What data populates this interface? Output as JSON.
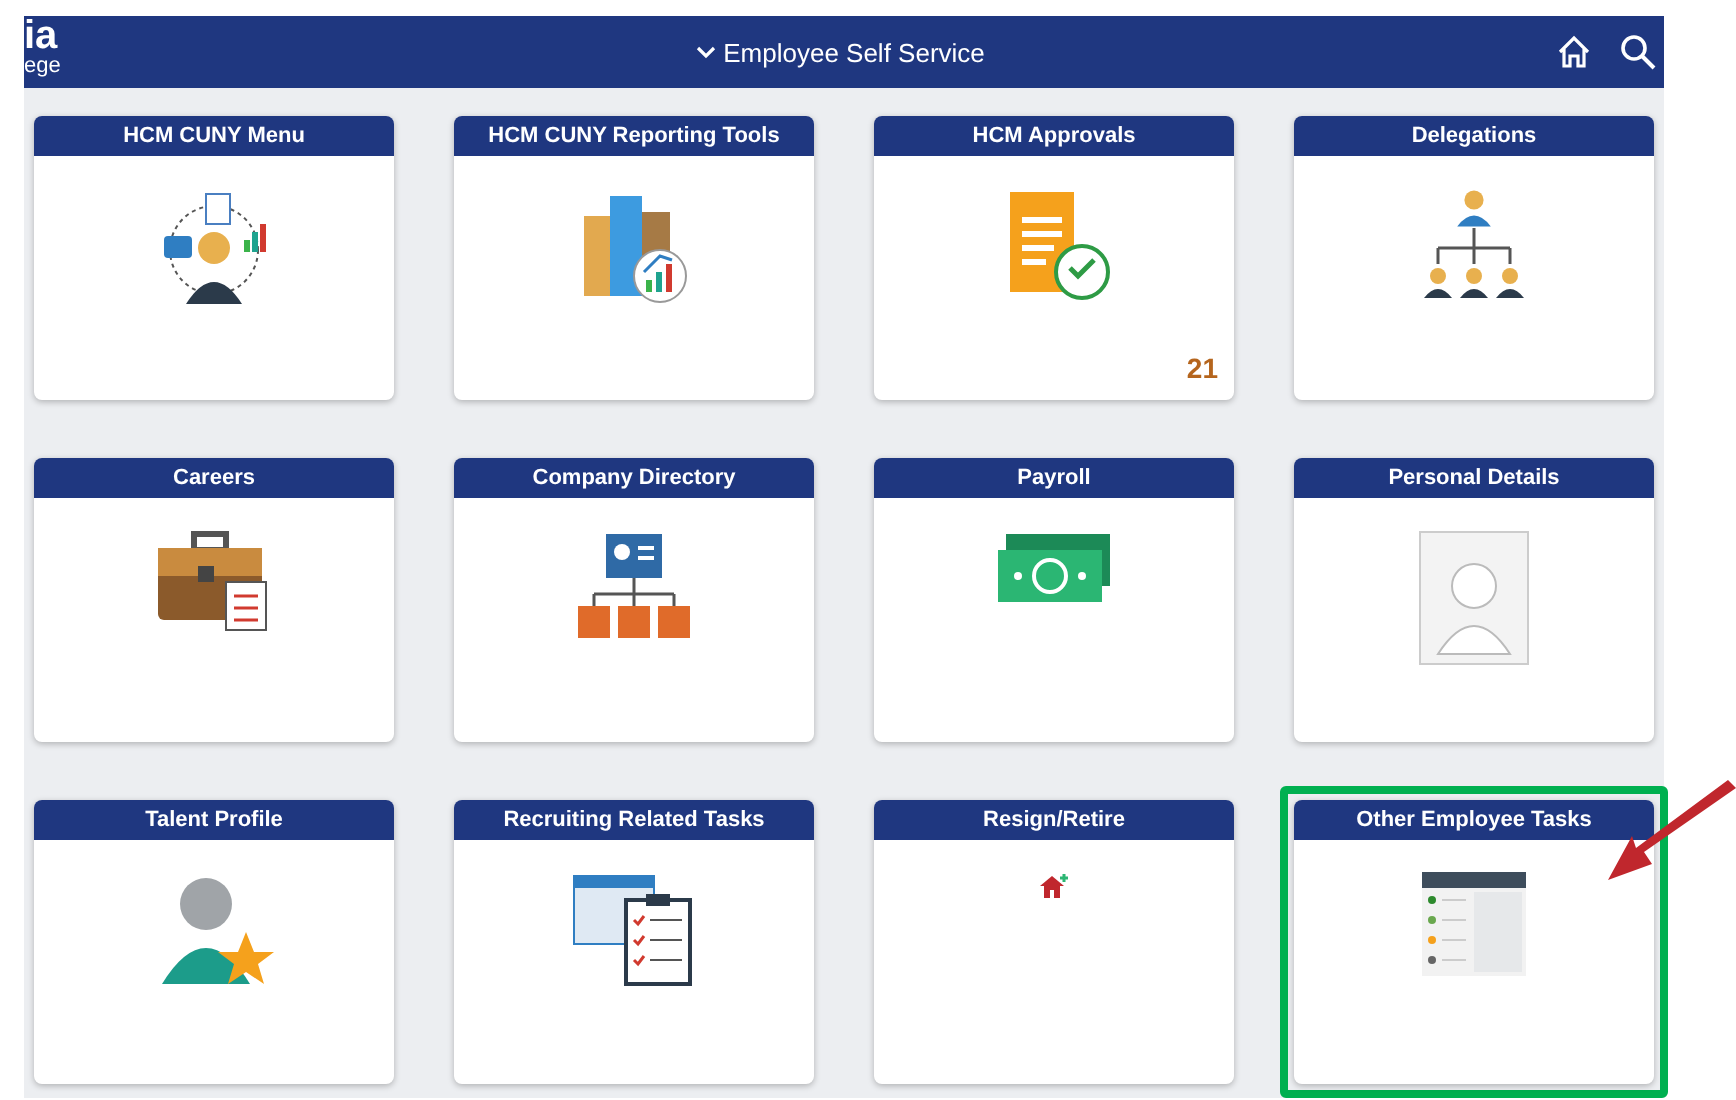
{
  "header": {
    "logo_line_1": "ia",
    "logo_line_2": "ege",
    "title": "Employee Self Service"
  },
  "tiles": [
    {
      "title": "HCM CUNY Menu",
      "kind": "menu",
      "highlighted": false
    },
    {
      "title": "HCM CUNY Reporting Tools",
      "kind": "reporting",
      "highlighted": false
    },
    {
      "title": "HCM Approvals",
      "kind": "approvals",
      "count": "21",
      "highlighted": false
    },
    {
      "title": "Delegations",
      "kind": "delegations",
      "highlighted": false
    },
    {
      "title": "Careers",
      "kind": "careers",
      "highlighted": false
    },
    {
      "title": "Company Directory",
      "kind": "directory",
      "highlighted": false
    },
    {
      "title": "Payroll",
      "kind": "payroll",
      "highlighted": false
    },
    {
      "title": "Personal Details",
      "kind": "personal",
      "highlighted": false
    },
    {
      "title": "Talent Profile",
      "kind": "talent",
      "highlighted": false
    },
    {
      "title": "Recruiting Related Tasks",
      "kind": "recruiting",
      "highlighted": false
    },
    {
      "title": "Resign/Retire",
      "kind": "resign",
      "highlighted": false
    },
    {
      "title": "Other Employee Tasks",
      "kind": "other",
      "highlighted": true
    }
  ]
}
